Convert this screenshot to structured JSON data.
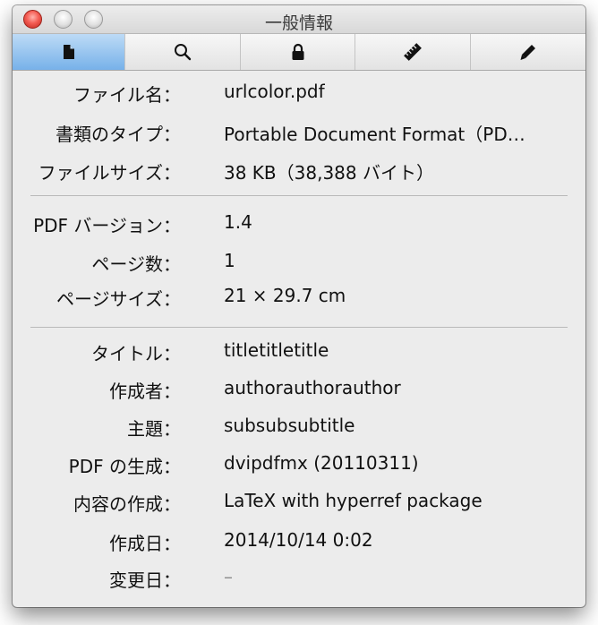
{
  "window": {
    "title": "一般情報"
  },
  "toolbar": {
    "tabs": [
      {
        "name": "document",
        "icon": "document-icon",
        "active": true
      },
      {
        "name": "search",
        "icon": "magnifier-icon",
        "active": false
      },
      {
        "name": "security",
        "icon": "lock-icon",
        "active": false
      },
      {
        "name": "ruler",
        "icon": "ruler-icon",
        "active": false
      },
      {
        "name": "annotate",
        "icon": "pen-icon",
        "active": false
      }
    ]
  },
  "file_info": {
    "name": {
      "label": "ファイル名：",
      "value": "urlcolor.pdf"
    },
    "kind": {
      "label": "書類のタイプ：",
      "value": "Portable Document Format（PD…"
    },
    "size": {
      "label": "ファイルサイズ：",
      "value": "38 KB（38,388 バイト）"
    }
  },
  "pdf_info": {
    "version": {
      "label": "PDF バージョン：",
      "value": "1.4"
    },
    "pages": {
      "label": "ページ数：",
      "value": "1"
    },
    "page_size": {
      "label": "ページサイズ：",
      "value": "21 × 29.7 cm"
    }
  },
  "metadata": {
    "title": {
      "label": "タイトル：",
      "value": "titletitletitle"
    },
    "author": {
      "label": "作成者：",
      "value": "authorauthorauthor"
    },
    "subject": {
      "label": "主題：",
      "value": "subsubsubtitle"
    },
    "producer": {
      "label": "PDF の生成：",
      "value": "dvipdfmx (20110311)"
    },
    "creator": {
      "label": "内容の作成：",
      "value": "LaTeX with hyperref package"
    },
    "created": {
      "label": "作成日：",
      "value": "2014/10/14 0:02"
    },
    "modified": {
      "label": "変更日：",
      "value": "–"
    }
  }
}
